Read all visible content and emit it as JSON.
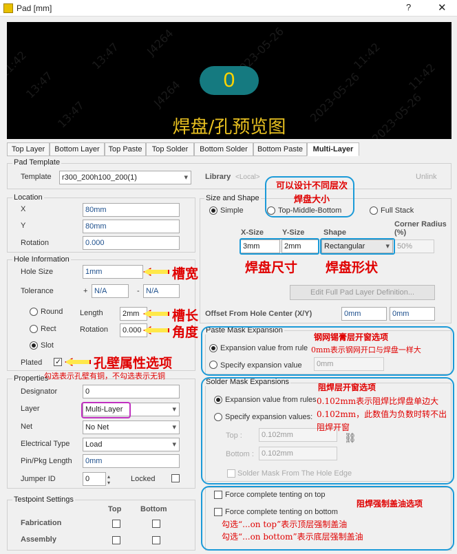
{
  "window": {
    "title": "Pad [mm]",
    "help": "?",
    "close": "✕"
  },
  "preview": {
    "number": "0",
    "label": "焊盘/孔预览图",
    "watermarks": [
      "11:42",
      "13:47",
      "J4264",
      "2023-05-26",
      "11:42",
      "13:47",
      "J4264",
      "2023-05-26",
      "11:42",
      "13:47",
      "2023-05-26"
    ]
  },
  "tabs": [
    "Top Layer",
    "Bottom Layer",
    "Top Paste",
    "Top Solder",
    "Bottom Solder",
    "Bottom Paste",
    "Multi-Layer"
  ],
  "pad_template": {
    "group": "Pad Template",
    "template_label": "Template",
    "template_value": "r300_200h100_200(1)",
    "library_label": "Library",
    "library_value": "<Local>",
    "unlink": "Unlink"
  },
  "location": {
    "group": "Location",
    "x_label": "X",
    "x": "80mm",
    "y_label": "Y",
    "y": "80mm",
    "rot_label": "Rotation",
    "rot": "0.000"
  },
  "hole": {
    "group": "Hole Information",
    "size_label": "Hole Size",
    "size": "1mm",
    "tol_label": "Tolerance",
    "tol_plus": "+",
    "tol_plus_val": "N/A",
    "tol_minus": "-",
    "tol_minus_val": "N/A",
    "round": "Round",
    "rect": "Rect",
    "slot": "Slot",
    "length_label": "Length",
    "length": "2mm",
    "rot_label": "Rotation",
    "rot": "0.000",
    "plated": "Plated"
  },
  "properties": {
    "group": "Properties",
    "designator_label": "Designator",
    "designator": "0",
    "layer_label": "Layer",
    "layer": "Multi-Layer",
    "net_label": "Net",
    "net": "No Net",
    "etype_label": "Electrical Type",
    "etype": "Load",
    "pin_label": "Pin/Pkg Length",
    "pin": "0mm",
    "jumper_label": "Jumper ID",
    "jumper": "0",
    "locked": "Locked"
  },
  "testpoint": {
    "group": "Testpoint Settings",
    "top": "Top",
    "bottom": "Bottom",
    "fab": "Fabrication",
    "asm": "Assembly"
  },
  "size_shape": {
    "group": "Size and Shape",
    "simple": "Simple",
    "tmb": "Top-Middle-Bottom",
    "full": "Full Stack",
    "xsize_h": "X-Size",
    "ysize_h": "Y-Size",
    "shape_h": "Shape",
    "corner_h": "Corner Radius (%)",
    "xsize": "3mm",
    "ysize": "2mm",
    "shape": "Rectangular",
    "corner": "50%",
    "edit_btn": "Edit Full Pad Layer Definition...",
    "offset_label": "Offset From Hole Center (X/Y)",
    "offset_x": "0mm",
    "offset_y": "0mm"
  },
  "paste": {
    "group": "Paste Mask Expansion",
    "rule": "Expansion value from rule",
    "specify": "Specify expansion value",
    "value": "0mm"
  },
  "solder": {
    "group": "Solder Mask Expansions",
    "rule": "Expansion value from rules",
    "specify": "Specify expansion values:",
    "top_label": "Top :",
    "top": "0.102mm",
    "bottom_label": "Bottom :",
    "bottom": "0.102mm",
    "from_hole": "Solder Mask From The Hole Edge"
  },
  "tenting": {
    "top": "Force complete tenting on top",
    "bottom": "Force complete tenting on bottom"
  },
  "annotations": {
    "slot_width": "槽宽",
    "slot_length": "槽长",
    "angle": "角度",
    "plated": "孔壁属性选项",
    "plated_note": "勾选表示孔壁有铜，不勾选表示无铜",
    "layer_size": "可以设计不同层次焊盘大小",
    "pad_size": "焊盘尺寸",
    "pad_shape": "焊盘形状",
    "paste_title": "钢网锡膏层开窗选项",
    "paste_note": "0mm表示钢网开口与焊盘一样大",
    "solder_title": "阻焊层开窗选项",
    "solder_note": "0.102mm表示阻焊比焊盘单边大0.102mm，此数值为负数时转不出阻焊开窗",
    "tent_title": "阻焊强制盖油选项",
    "tent_note1": "勾选“...on top”表示顶层强制盖油",
    "tent_note2": "勾选“...on bottom”表示底层强制盖油"
  }
}
